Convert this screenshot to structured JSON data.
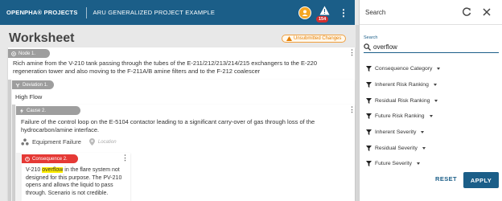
{
  "header": {
    "project": "OPENPHA® PROJECTS",
    "path": "ARU GENERALIZED PROJECT EXAMPLE",
    "notifications_count": "154"
  },
  "worksheet": {
    "title": "Worksheet",
    "status": "Unsubmitted Changes",
    "node": {
      "tag": "Node 1.",
      "text": "Rich amine from the V-210 tank passing through the tubes of the E-211/212/213/214/215 exchangers to the E-220 regeneration tower and also moving to the F-211A/B amine filters and to the F-212 coalescer"
    },
    "deviation": {
      "tag": "Deviation 1.",
      "text": "High Flow"
    },
    "cause": {
      "tag": "Cause 2.",
      "text": "Failure of the control loop on the E-5104 contactor leading to a significant carry-over of gas through loss of the hydrocarbon/amine interface.",
      "category": "Equipment Failure",
      "location_placeholder": "Location"
    },
    "consequence": {
      "tag": "Consequence 2.",
      "text_before": "V-210 ",
      "highlight": "overflow",
      "text_after": " in the flare system not designed for this purpose. The PV-210 opens and allows the liquid to pass through. Scenario is not credible."
    }
  },
  "search_panel": {
    "title": "Search",
    "field_label": "Search",
    "query": "overflow",
    "filters": [
      "Consequence Category",
      "Inherent Risk Ranking",
      "Residual Risk Ranking",
      "Future Risk Ranking",
      "Inherent Severity",
      "Residual Severity",
      "Future Severity"
    ],
    "reset_label": "RESET",
    "apply_label": "APPLY"
  },
  "colors": {
    "brand": "#1b5e88",
    "highlight": "#ffee00",
    "consequence": "#e53935",
    "warning": "#f5a623"
  }
}
